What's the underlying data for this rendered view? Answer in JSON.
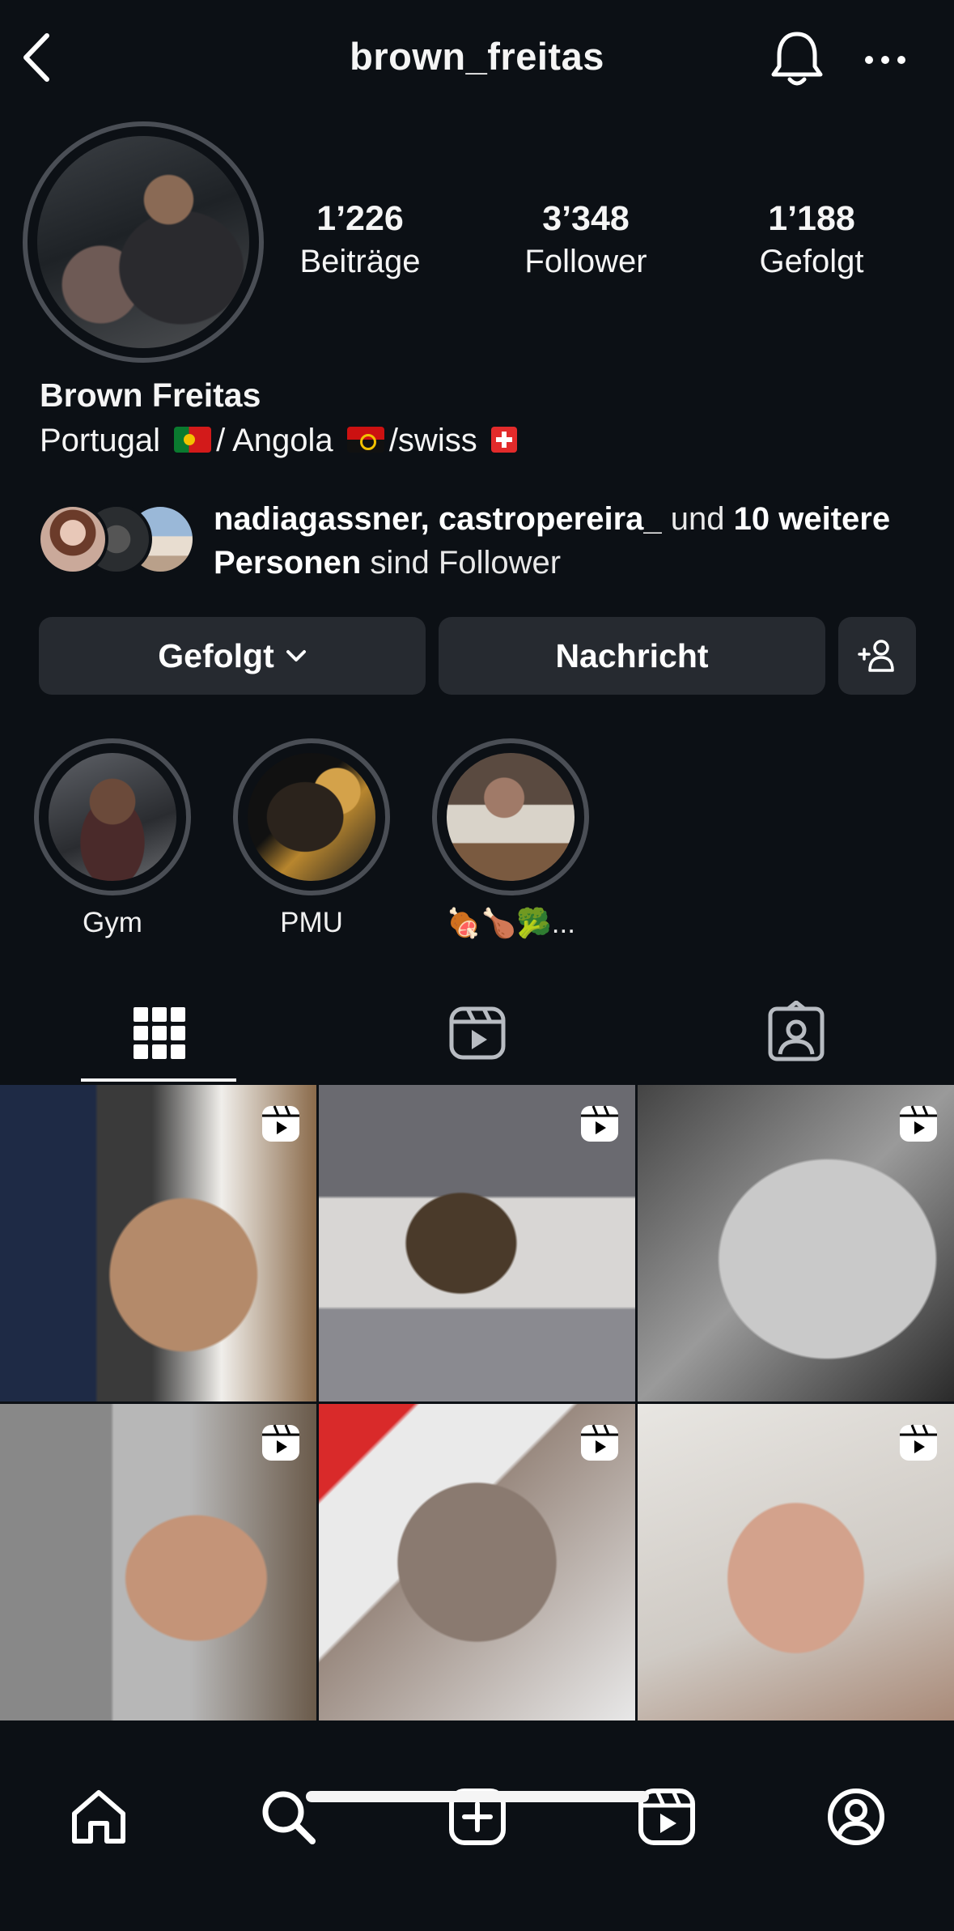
{
  "header": {
    "username": "brown_freitas"
  },
  "profile": {
    "stats": [
      {
        "value": "1’226",
        "label": "Beiträge"
      },
      {
        "value": "3’348",
        "label": "Follower"
      },
      {
        "value": "1’188",
        "label": "Gefolgt"
      }
    ],
    "name": "Brown Freitas",
    "bio": {
      "part1": "Portugal",
      "part2": "/ Angola",
      "part3": "/swiss"
    }
  },
  "followed_by": {
    "names": "nadiagassner, castropereira_",
    "und": "und",
    "count_bold": "10 weitere Personen",
    "suffix": "sind Follower"
  },
  "actions": {
    "following_label": "Gefolgt",
    "message_label": "Nachricht"
  },
  "highlights": [
    {
      "label": "Gym"
    },
    {
      "label": "PMU"
    },
    {
      "label": "🍖🍗🥦..."
    }
  ],
  "icons": {
    "back": "chevron-left-icon",
    "notifications": "bell-icon",
    "more": "ellipsis-icon",
    "add_user": "add-person-icon",
    "tabs": [
      "grid-icon",
      "reels-icon",
      "tagged-icon"
    ],
    "nav": [
      "home-icon",
      "search-icon",
      "create-icon",
      "reels-icon",
      "profile-icon"
    ]
  },
  "colors": {
    "background": "#0c1015",
    "button": "#262a30",
    "ring": "#4a4e55",
    "text": "#f5f5f5"
  }
}
